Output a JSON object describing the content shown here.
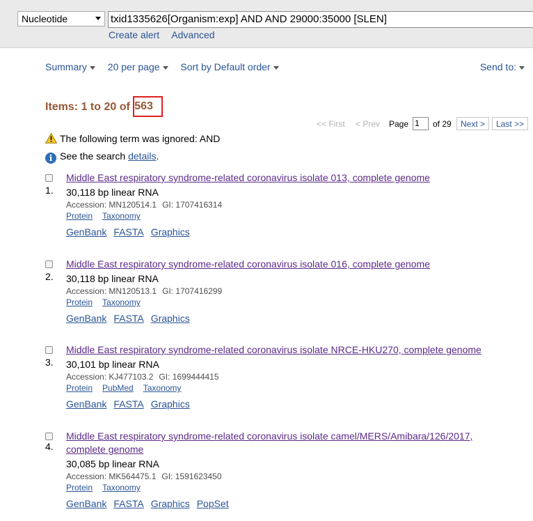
{
  "search": {
    "database": "Nucleotide",
    "query": "txid1335626[Organism:exp] AND AND 29000:35000 [SLEN]",
    "create_alert": "Create alert",
    "advanced": "Advanced"
  },
  "toolbar": {
    "summary": "Summary",
    "per_page": "20 per page",
    "sort": "Sort by Default order",
    "send_to": "Send to:"
  },
  "items": {
    "prefix": "Items: 1 to 20 of ",
    "total": "563"
  },
  "pager": {
    "first": "<< First",
    "prev": "< Prev",
    "page_label": "Page",
    "page": "1",
    "of": "of 29",
    "next": "Next >",
    "last": "Last >>"
  },
  "messages": {
    "warning": "The following term was ignored: AND",
    "info_prefix": "See the search ",
    "info_link": "details",
    "info_suffix": "."
  },
  "results": [
    {
      "num": "1.",
      "title": "Middle East respiratory syndrome-related coronavirus isolate 013, complete genome",
      "desc": "30,118 bp linear RNA",
      "accession": "Accession: MN120514.1",
      "gi": "GI: 1707416314",
      "links": [
        "Protein",
        "Taxonomy"
      ],
      "formats": [
        "GenBank",
        "FASTA",
        "Graphics"
      ]
    },
    {
      "num": "2.",
      "title": "Middle East respiratory syndrome-related coronavirus isolate 016, complete genome",
      "desc": "30,118 bp linear RNA",
      "accession": "Accession: MN120513.1",
      "gi": "GI: 1707416299",
      "links": [
        "Protein",
        "Taxonomy"
      ],
      "formats": [
        "GenBank",
        "FASTA",
        "Graphics"
      ]
    },
    {
      "num": "3.",
      "title": "Middle East respiratory syndrome-related coronavirus isolate NRCE-HKU270, complete genome",
      "desc": "30,101 bp linear RNA",
      "accession": "Accession: KJ477103.2",
      "gi": "GI: 1699444415",
      "links": [
        "Protein",
        "PubMed",
        "Taxonomy"
      ],
      "formats": [
        "GenBank",
        "FASTA",
        "Graphics"
      ]
    },
    {
      "num": "4.",
      "title": "Middle East respiratory syndrome-related coronavirus isolate camel/MERS/Amibara/126/2017, complete genome",
      "desc": "30,085 bp linear RNA",
      "accession": "Accession: MK564475.1",
      "gi": "GI: 1591623450",
      "links": [
        "Protein",
        "Taxonomy"
      ],
      "formats": [
        "GenBank",
        "FASTA",
        "Graphics",
        "PopSet"
      ]
    }
  ]
}
